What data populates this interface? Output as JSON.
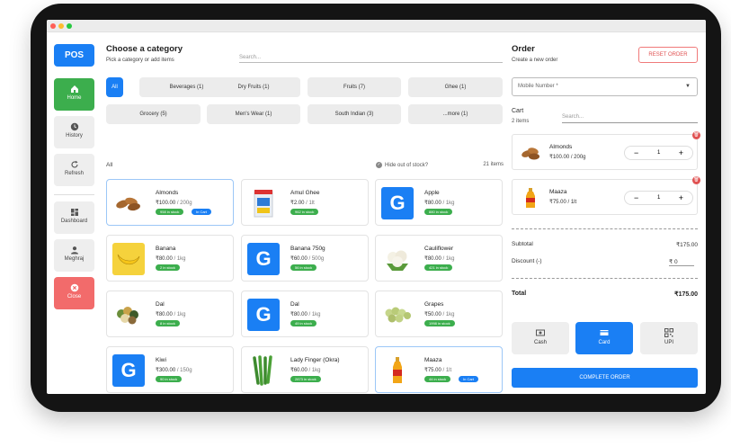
{
  "sidebar": {
    "logo": "POS",
    "items": [
      {
        "label": "Home"
      },
      {
        "label": "History"
      },
      {
        "label": "Refresh"
      },
      {
        "label": "Dashboard"
      },
      {
        "label": "Meghraj"
      },
      {
        "label": "Close"
      }
    ]
  },
  "catalog": {
    "title": "Choose a category",
    "subtitle": "Pick a category or add items",
    "search_placeholder": "Search...",
    "categories": [
      "All",
      "Beverages (1)",
      "Dry Fruits (1)",
      "Fruits (7)",
      "Ghee (1)",
      "Grocery (5)",
      "Men's Wear (1)",
      "South Indian (3)",
      "...more (1)"
    ],
    "filter_label": "All",
    "hide_out_of_stock": "Hide out of stock?",
    "item_count": "21 items",
    "products": [
      {
        "name": "Almonds",
        "price": "₹100.00",
        "unit": "/ 200g",
        "stock": "958 in stock",
        "in_cart": "In Cart"
      },
      {
        "name": "Amul Ghee",
        "price": "₹2.00",
        "unit": "/ 1lt",
        "stock": "962 in stock"
      },
      {
        "name": "Apple",
        "price": "₹80.00",
        "unit": "/ 1kg",
        "stock": "880 in stock",
        "letter": "G"
      },
      {
        "name": "Banana",
        "price": "₹80.00",
        "unit": "/ 1kg",
        "stock": "2 in stock"
      },
      {
        "name": "Banana 750g",
        "price": "₹60.00",
        "unit": "/ 500g",
        "stock": "56 in stock",
        "letter": "G"
      },
      {
        "name": "Cauliflower",
        "price": "₹80.00",
        "unit": "/ 1kg",
        "stock": "421 in stock"
      },
      {
        "name": "Dal",
        "price": "₹80.00",
        "unit": "/ 1kg",
        "stock": "8 in stock"
      },
      {
        "name": "Dal",
        "price": "₹80.00",
        "unit": "/ 1kg",
        "stock": "49 in stock",
        "letter": "G"
      },
      {
        "name": "Grapes",
        "price": "₹50.00",
        "unit": "/ 1kg",
        "stock": "1998 in stock"
      },
      {
        "name": "Kiwi",
        "price": "₹300.00",
        "unit": "/ 150g",
        "stock": "90 in stock",
        "letter": "G"
      },
      {
        "name": "Lady Finger (Okra)",
        "price": "₹60.00",
        "unit": "/ 1kg",
        "stock": "2873 in stock"
      },
      {
        "name": "Maaza",
        "price": "₹75.00",
        "unit": "/ 1lt",
        "stock": "44 in stock",
        "in_cart": "In Cart"
      }
    ]
  },
  "order": {
    "title": "Order",
    "subtitle": "Create a new order",
    "reset_label": "RESET ORDER",
    "mobile_placeholder": "Mobile Number *",
    "cart_label": "Cart",
    "cart_count": "2 items",
    "cart_search_placeholder": "Search...",
    "cart_items": [
      {
        "name": "Almonds",
        "price": "₹100.00 / 200g",
        "qty": "1"
      },
      {
        "name": "Maaza",
        "price": "₹75.00 / 1lt",
        "qty": "1"
      }
    ],
    "subtotal_label": "Subtotal",
    "subtotal_value": "₹175.00",
    "discount_label": "Discount (-)",
    "discount_value": "₹ 0",
    "total_label": "Total",
    "total_value": "₹175.00",
    "payment_methods": [
      "Cash",
      "Card",
      "UPI"
    ],
    "complete_label": "COMPLETE ORDER"
  },
  "colors": {
    "primary": "#1a7ff4",
    "success": "#3cae4d",
    "danger": "#f26b6b"
  }
}
